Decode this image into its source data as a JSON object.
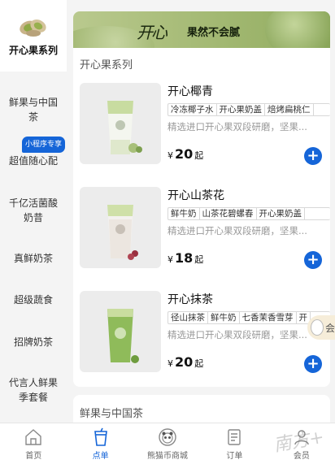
{
  "sidebar": {
    "items": [
      {
        "label": "开心果系列",
        "active": true,
        "icon": "pistachio-icon"
      },
      {
        "label": "鲜果与中国茶"
      },
      {
        "label": "超值随心配",
        "badge": "小程序专享"
      },
      {
        "label": "千亿活菌酸奶昔"
      },
      {
        "label": "真鲜奶茶"
      },
      {
        "label": "超级蔬食"
      },
      {
        "label": "招牌奶茶"
      },
      {
        "label": "代言人鲜果季套餐"
      }
    ]
  },
  "banner": {
    "logo": "开心",
    "slogan": "果然不会腻"
  },
  "section": {
    "title": "开心果系列"
  },
  "products": [
    {
      "name": "开心椰青",
      "tags": [
        "冷冻椰子水",
        "开心果奶盖",
        "焙烤扁桃仁"
      ],
      "desc": "精选进口开心果双段研磨，坚果...",
      "currency": "¥",
      "price": "20",
      "suffix": "起",
      "color": "#e8eedd"
    },
    {
      "name": "开心山茶花",
      "tags": [
        "鲜牛奶",
        "山茶花碧螺春",
        "开心果奶盖"
      ],
      "desc": "精选进口开心果双段研磨，坚果...",
      "currency": "¥",
      "price": "18",
      "suffix": "起",
      "color": "#eee9e5"
    },
    {
      "name": "开心抹茶",
      "tags": [
        "径山抹茶",
        "鲜牛奶",
        "七香茉香雪芽",
        "开"
      ],
      "desc": "精选进口开心果双段研磨，坚果...",
      "currency": "¥",
      "price": "20",
      "suffix": "起",
      "color": "#9cc26a"
    }
  ],
  "next_section": {
    "title": "鲜果与中国茶"
  },
  "float": {
    "label": "会"
  },
  "tabbar": {
    "items": [
      {
        "label": "首页",
        "icon": "home-icon"
      },
      {
        "label": "点单",
        "icon": "cup-icon",
        "active": true
      },
      {
        "label": "熊猫币商城",
        "icon": "panda-coin-icon"
      },
      {
        "label": "订单",
        "icon": "order-icon"
      },
      {
        "label": "会员",
        "icon": "member-icon"
      }
    ]
  },
  "watermark": "南方+",
  "colors": {
    "accent": "#1565d8",
    "banner": "#a9bd7a"
  }
}
